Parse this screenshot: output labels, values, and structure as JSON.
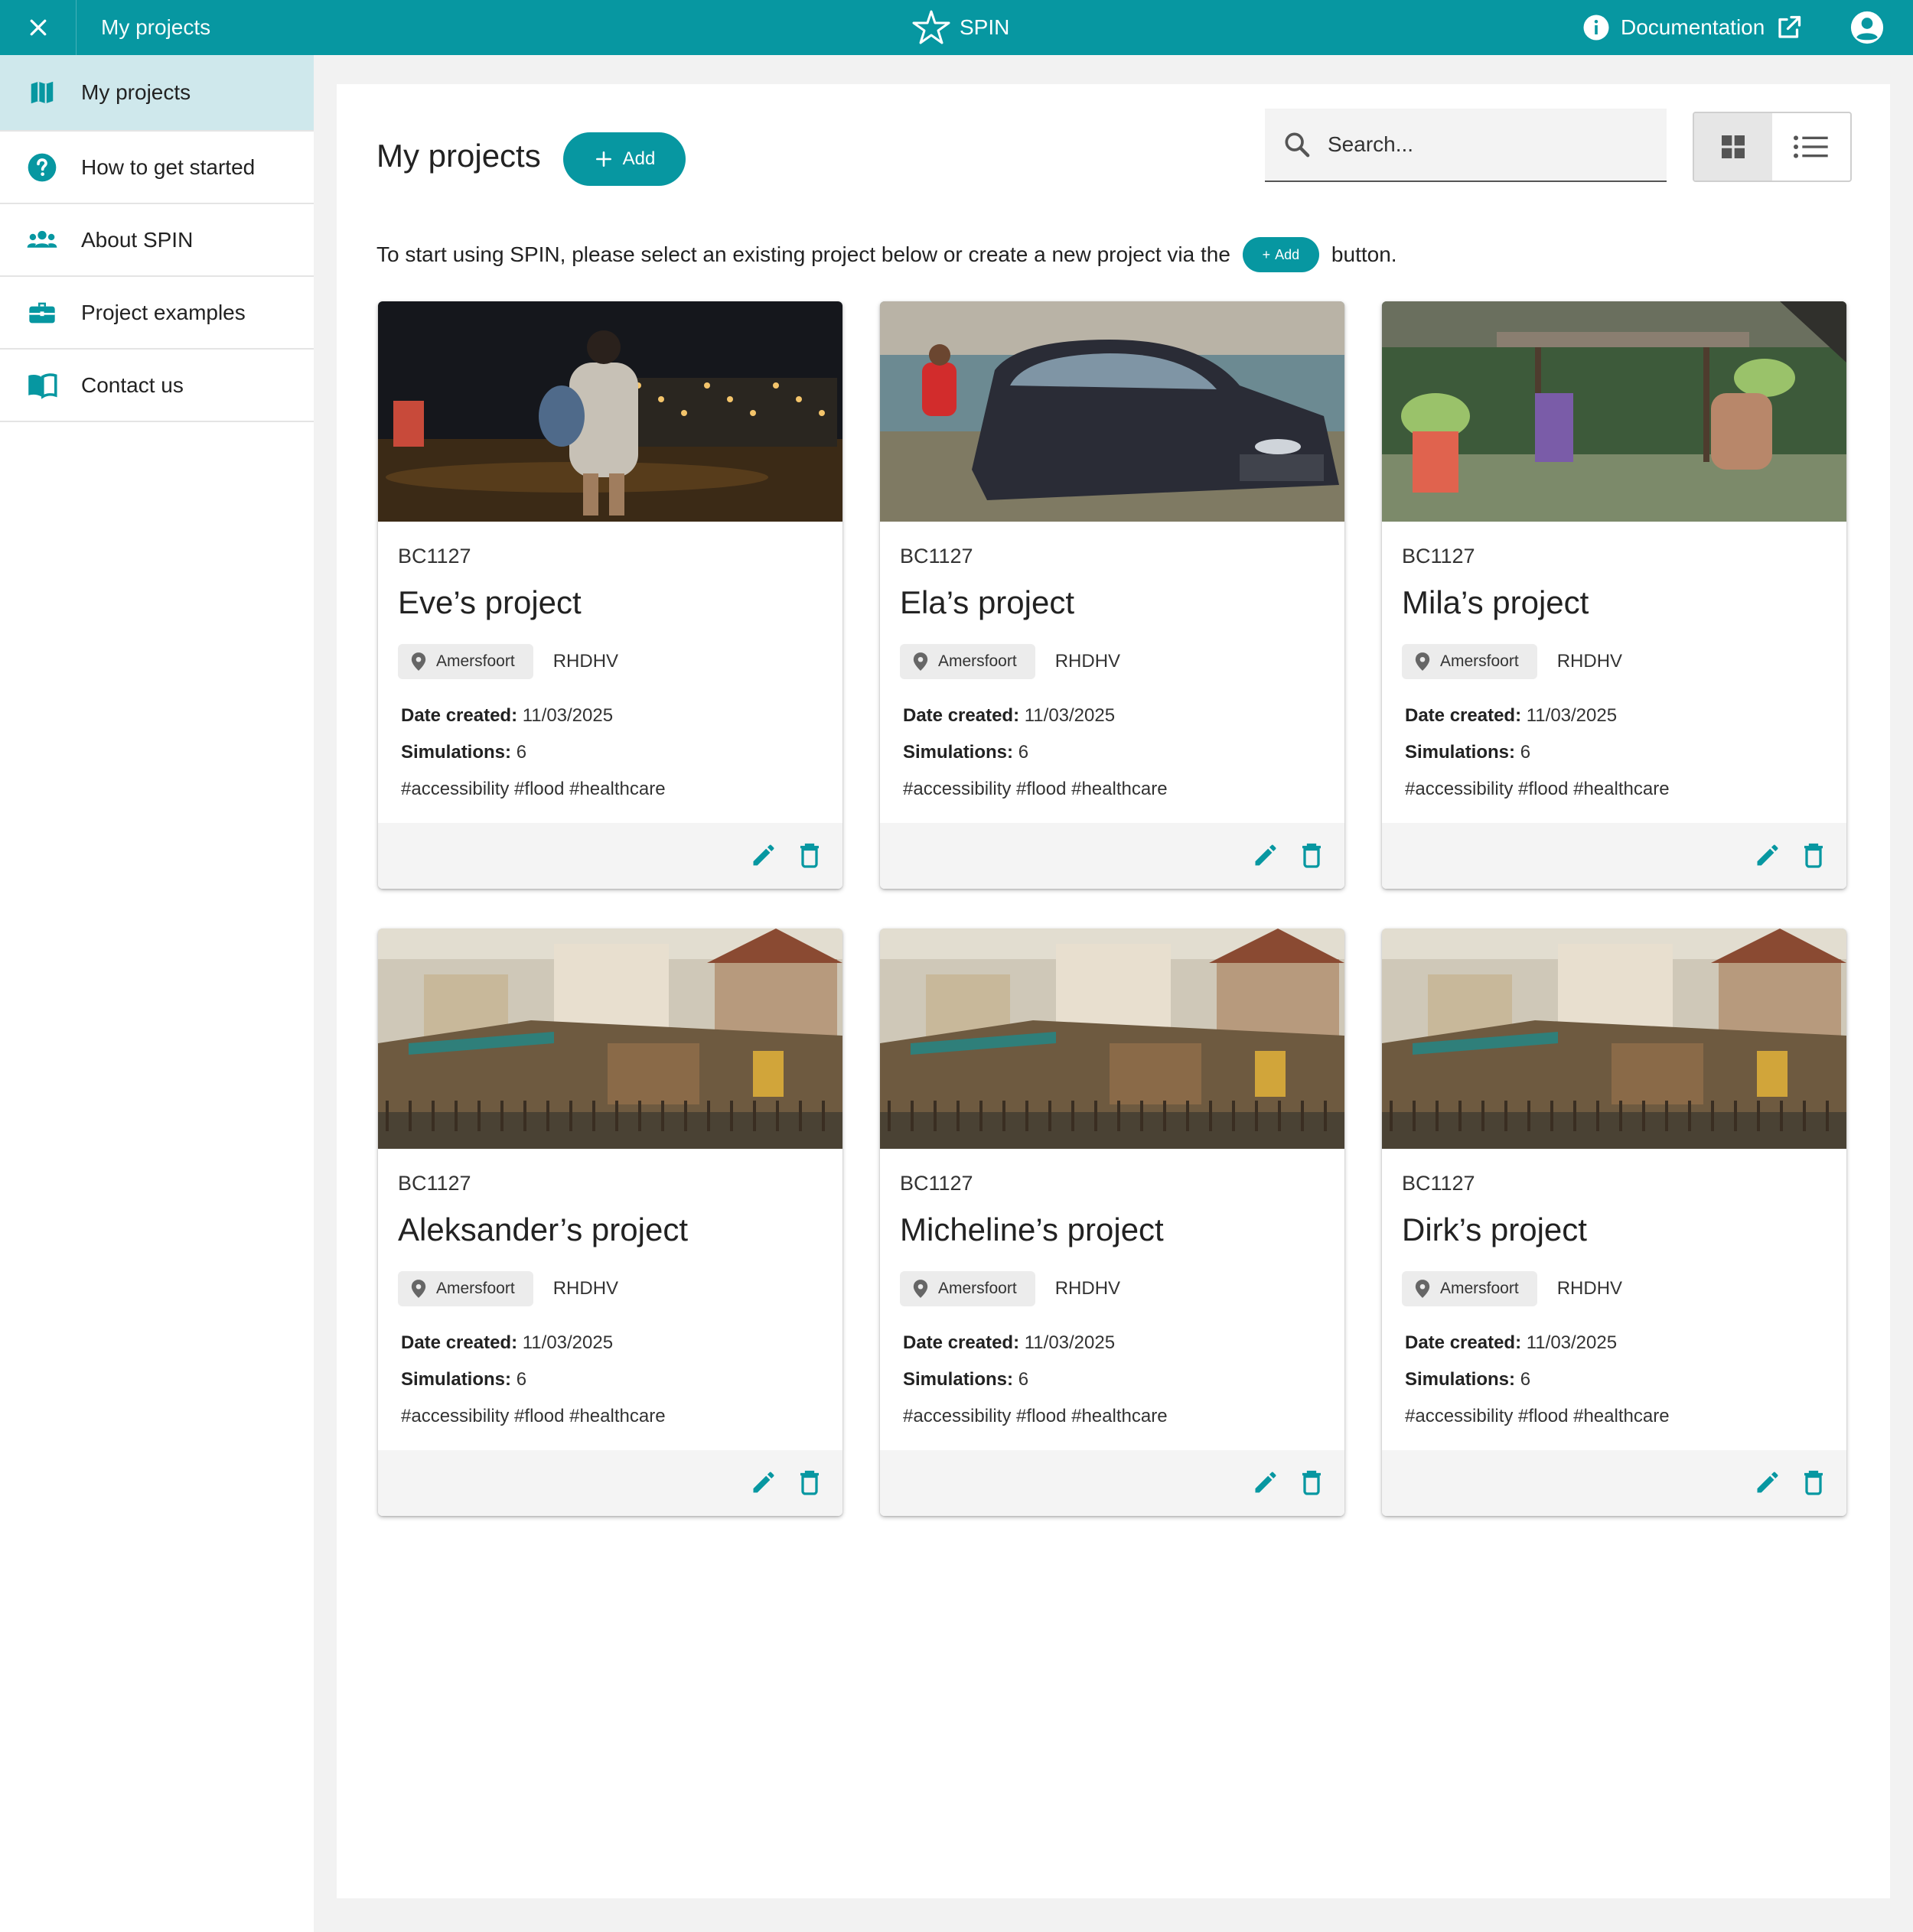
{
  "topbar": {
    "breadcrumb": "My projects",
    "brand": "SPIN",
    "documentation_label": "Documentation"
  },
  "sidebar": {
    "items": [
      {
        "label": "My projects",
        "icon": "map-icon",
        "active": true
      },
      {
        "label": "How to get started",
        "icon": "help-circle-icon"
      },
      {
        "label": "About SPIN",
        "icon": "people-icon"
      },
      {
        "label": "Project examples",
        "icon": "briefcase-icon"
      },
      {
        "label": "Contact us",
        "icon": "book-icon"
      }
    ]
  },
  "main": {
    "title": "My projects",
    "add_label": "Add",
    "search_placeholder": "Search...",
    "intro_before": "To start using SPIN, please select an existing project below or create a new project via the",
    "intro_add_label": "Add",
    "intro_after": "button."
  },
  "projects": [
    {
      "code": "BC1127",
      "title": "Eve’s project",
      "location": "Amersfoort",
      "org": "RHDHV",
      "date_label": "Date created:",
      "date": "11/03/2025",
      "sims_label": "Simulations:",
      "sims": "6",
      "tags": "#accessibility #flood #healthcare",
      "image": "night-flood-street"
    },
    {
      "code": "BC1127",
      "title": "Ela’s project",
      "location": "Amersfoort",
      "org": "RHDHV",
      "date_label": "Date created:",
      "date": "11/03/2025",
      "sims_label": "Simulations:",
      "sims": "6",
      "tags": "#accessibility #flood #healthcare",
      "image": "flooded-car"
    },
    {
      "code": "BC1127",
      "title": "Mila’s project",
      "location": "Amersfoort",
      "org": "RHDHV",
      "date_label": "Date created:",
      "date": "11/03/2025",
      "sims_label": "Simulations:",
      "sims": "6",
      "tags": "#accessibility #flood #healthcare",
      "image": "flood-relief"
    },
    {
      "code": "BC1127",
      "title": "Aleksander’s project",
      "location": "Amersfoort",
      "org": "RHDHV",
      "date_label": "Date created:",
      "date": "11/03/2025",
      "sims_label": "Simulations:",
      "sims": "6",
      "tags": "#accessibility #flood #healthcare",
      "image": "riverside-houses"
    },
    {
      "code": "BC1127",
      "title": "Micheline’s project",
      "location": "Amersfoort",
      "org": "RHDHV",
      "date_label": "Date created:",
      "date": "11/03/2025",
      "sims_label": "Simulations:",
      "sims": "6",
      "tags": "#accessibility #flood #healthcare",
      "image": "riverside-houses"
    },
    {
      "code": "BC1127",
      "title": "Dirk’s project",
      "location": "Amersfoort",
      "org": "RHDHV",
      "date_label": "Date created:",
      "date": "11/03/2025",
      "sims_label": "Simulations:",
      "sims": "6",
      "tags": "#accessibility #flood #healthcare",
      "image": "riverside-houses"
    }
  ],
  "colors": {
    "accent": "#0797a1",
    "active_nav": "#cfe8ec",
    "page_bg": "#f2f2f2"
  }
}
